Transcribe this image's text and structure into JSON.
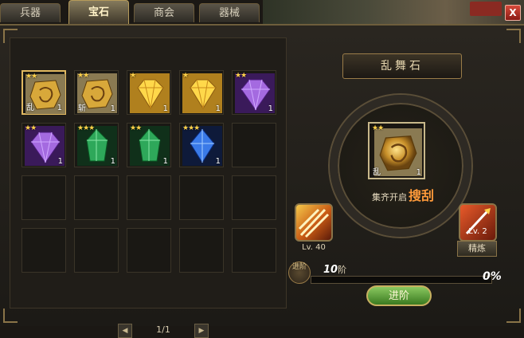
{
  "tabs": [
    {
      "label": "兵器",
      "active": false
    },
    {
      "label": "宝石",
      "active": true
    },
    {
      "label": "商会",
      "active": false
    },
    {
      "label": "器械",
      "active": false
    }
  ],
  "close_label": "X",
  "inventory": {
    "slots": [
      {
        "gem": "gold-rune",
        "stars": 2,
        "char": "乱",
        "qty": "1",
        "selected": true
      },
      {
        "gem": "gold-rune",
        "stars": 2,
        "char": "斩",
        "qty": "1",
        "selected": false
      },
      {
        "gem": "gold-diamond",
        "stars": 1,
        "char": "",
        "qty": "1",
        "selected": false
      },
      {
        "gem": "gold-diamond",
        "stars": 1,
        "char": "",
        "qty": "1",
        "selected": false
      },
      {
        "gem": "purple-diamond",
        "stars": 2,
        "char": "",
        "qty": "1",
        "selected": false
      },
      {
        "gem": "purple-diamond",
        "stars": 2,
        "char": "",
        "qty": "1",
        "selected": false
      },
      {
        "gem": "green-crystal",
        "stars": 3,
        "char": "",
        "qty": "1",
        "selected": false
      },
      {
        "gem": "green-crystal",
        "stars": 2,
        "char": "",
        "qty": "1",
        "selected": false
      },
      {
        "gem": "blue-crystal",
        "stars": 3,
        "char": "",
        "qty": "1",
        "selected": false
      }
    ],
    "total_slots": 20,
    "page": "1/1"
  },
  "detail": {
    "title": "乱舞石",
    "item": {
      "gem": "gold-rune",
      "stars": 2,
      "char": "乱",
      "qty": "1"
    },
    "collect_text": "集齐开启",
    "collect_skill": "搜刮",
    "left_skill_level": "Lv. 40",
    "right_skill_level": "Lv. 2",
    "refine_label": "精炼",
    "stage_icon_label": "进阶",
    "stage_value": "10",
    "stage_unit": "阶",
    "progress_percent": 0,
    "progress_text": "0%",
    "advance_label": "进阶"
  },
  "colors": {
    "accent": "#e0b860",
    "star": "#ffd24a",
    "advance": "#5aa03a"
  },
  "icons": {
    "prev": "arrow-left-icon",
    "next": "arrow-right-icon",
    "skill": "flame-slash-icon",
    "refine": "sword-fire-icon"
  }
}
